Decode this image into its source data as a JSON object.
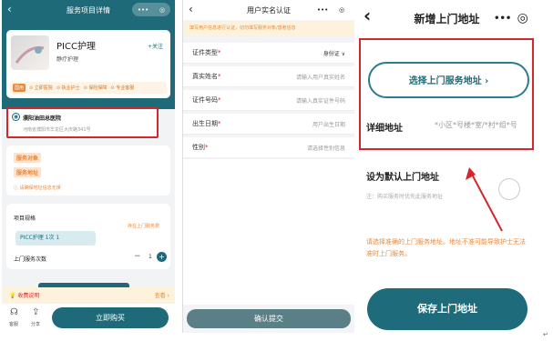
{
  "p1": {
    "title": "服务项目详情",
    "more": "•••",
    "service_name": "PICC护理",
    "follow": "+关注",
    "sub": "静疗护理",
    "badge": "国用",
    "features": [
      "立即医院",
      "执业护士",
      "保险保障",
      "专业客服"
    ],
    "hospital": "濮阳油田总医院",
    "address": "河南省濮阳市华龙区大庆路341号",
    "tags": [
      "服务对象",
      "服务地址"
    ],
    "warn": "请确保地址信息无误",
    "spec_label": "项目规格",
    "spec_link": "存在上门服务费",
    "chip": "PICC护理 1次 1",
    "count_label": "上门服务次数",
    "count_value": "1",
    "fee_label": "收费说明",
    "fee_link": "查看 ›",
    "nav": [
      "客服",
      "分享"
    ],
    "buy": "立即购买"
  },
  "p2": {
    "title": "用户实名认证",
    "more": "•••",
    "notice": "填写用户信息进行认证，切勿填写服务对象/患者信息",
    "fields": [
      {
        "label": "证件类型",
        "value": "身份证 ∨",
        "value_dark": true
      },
      {
        "label": "真实姓名",
        "value": "请输入用户真实姓名",
        "value_dark": false
      },
      {
        "label": "证件号码",
        "value": "请输入真实证件号码",
        "value_dark": false
      },
      {
        "label": "出生日期",
        "value": "用户出生日期",
        "value_dark": false
      },
      {
        "label": "性别",
        "value": "请选择性别信息",
        "value_dark": false
      }
    ],
    "submit": "确认提交"
  },
  "p3": {
    "title": "新增上门地址",
    "more": "•••",
    "select_btn": "选择上门服务地址 ›",
    "detail_label": "详细地址",
    "detail_ph": "*小区*号楼*室/*村*组*号",
    "default_label": "设为默认上门地址",
    "default_note": "注：购买服务时优先此服务地址",
    "warning": "请选择准确的上门服务地址。地址不准可能导致护士无法准时上门服务。",
    "save": "保存上门地址"
  },
  "colors": {
    "teal": "#1e6b7b",
    "red": "#d2272d",
    "orange": "#e8883a"
  }
}
